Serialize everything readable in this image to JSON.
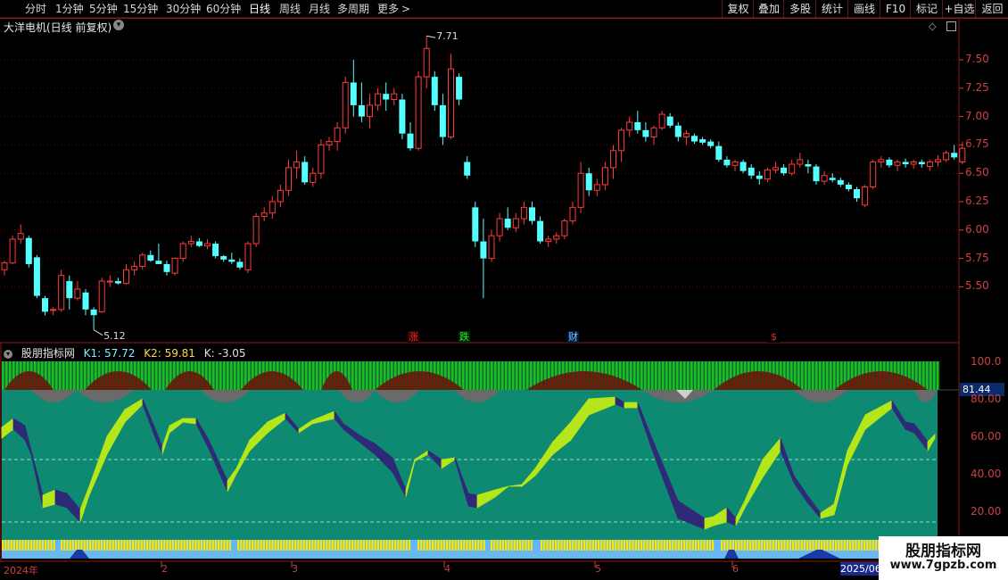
{
  "toolbar": {
    "periods": [
      {
        "label": "分时"
      },
      {
        "label": "1分钟"
      },
      {
        "label": "5分钟"
      },
      {
        "label": "15分钟"
      },
      {
        "label": "30分钟"
      },
      {
        "label": "60分钟"
      },
      {
        "label": "日线"
      },
      {
        "label": "周线"
      },
      {
        "label": "月线"
      },
      {
        "label": "多周期"
      },
      {
        "label": "更多"
      }
    ],
    "right_buttons": [
      {
        "label": "复权"
      },
      {
        "label": "叠加"
      },
      {
        "label": "多股"
      },
      {
        "label": "统计"
      },
      {
        "label": "画线"
      },
      {
        "label": "F10"
      },
      {
        "label": "标记"
      },
      {
        "label": "+自选"
      },
      {
        "label": "返回"
      }
    ],
    "more_chevron": ">"
  },
  "main_chart": {
    "title": "大洋电机(日线 前复权)",
    "high_label": "7.71",
    "low_label": "5.12",
    "y_ticks": [
      "7.50",
      "7.25",
      "7.00",
      "6.75",
      "6.50",
      "6.25",
      "6.00",
      "5.75",
      "5.50"
    ],
    "events": [
      {
        "text": "涨",
        "color": "#e03030",
        "bg": "#2a0000"
      },
      {
        "text": "跌",
        "color": "#30e030",
        "bg": "#002a00"
      },
      {
        "text": "财",
        "color": "#80c0ff",
        "bg": "#001a3a"
      },
      {
        "text": "$",
        "color": "#e03030",
        "bg": "#000000"
      }
    ]
  },
  "indicator": {
    "name": "股朋指标网",
    "k1": "K1: 57.72",
    "k2": "K2: 59.81",
    "k": "K: -3.05",
    "current_value": "81.44",
    "y_ticks": [
      "100.0",
      "80.00",
      "60.00",
      "40.00",
      "20.00"
    ]
  },
  "x_axis": {
    "labels": [
      "2024年",
      "2",
      "3",
      "4",
      "5",
      "6"
    ],
    "current_date": "2025/06"
  },
  "watermark": {
    "title": "股朋指标网",
    "url": "www.7gpzb.com"
  },
  "colors": {
    "up": "#ff3b3b",
    "down": "#54ffff",
    "grid": "#7a0000",
    "teal": "#0f8a72",
    "lime": "#b4e61a",
    "purple": "#2e2a78"
  },
  "chart_data": {
    "type": "candlestick",
    "series": [
      {
        "name": "大洋电机",
        "candles": [
          [
            5.65,
            5.73,
            5.6,
            5.71
          ],
          [
            5.71,
            5.95,
            5.7,
            5.92
          ],
          [
            5.92,
            6.05,
            5.88,
            5.97
          ],
          [
            5.93,
            5.95,
            5.67,
            5.7
          ],
          [
            5.76,
            5.78,
            5.4,
            5.42
          ],
          [
            5.4,
            5.42,
            5.25,
            5.28
          ],
          [
            5.3,
            5.32,
            5.25,
            5.3
          ],
          [
            5.3,
            5.65,
            5.28,
            5.6
          ],
          [
            5.55,
            5.6,
            5.3,
            5.4
          ],
          [
            5.4,
            5.55,
            5.38,
            5.48
          ],
          [
            5.45,
            5.48,
            5.25,
            5.3
          ],
          [
            5.3,
            5.32,
            5.12,
            5.25
          ],
          [
            5.28,
            5.58,
            5.27,
            5.55
          ],
          [
            5.55,
            5.6,
            5.5,
            5.55
          ],
          [
            5.55,
            5.58,
            5.52,
            5.53
          ],
          [
            5.53,
            5.7,
            5.52,
            5.65
          ],
          [
            5.65,
            5.72,
            5.6,
            5.68
          ],
          [
            5.68,
            5.8,
            5.65,
            5.78
          ],
          [
            5.78,
            5.82,
            5.72,
            5.73
          ],
          [
            5.73,
            5.88,
            5.72,
            5.7
          ],
          [
            5.7,
            5.73,
            5.6,
            5.63
          ],
          [
            5.62,
            5.76,
            5.6,
            5.75
          ],
          [
            5.75,
            5.9,
            5.72,
            5.88
          ],
          [
            5.88,
            5.95,
            5.85,
            5.9
          ],
          [
            5.9,
            5.93,
            5.85,
            5.86
          ],
          [
            5.86,
            5.92,
            5.83,
            5.88
          ],
          [
            5.88,
            5.9,
            5.75,
            5.77
          ],
          [
            5.77,
            5.78,
            5.72,
            5.74
          ],
          [
            5.74,
            5.8,
            5.7,
            5.72
          ],
          [
            5.72,
            5.75,
            5.65,
            5.67
          ],
          [
            5.65,
            5.9,
            5.62,
            5.88
          ],
          [
            5.88,
            6.15,
            5.85,
            6.12
          ],
          [
            6.12,
            6.2,
            6.08,
            6.15
          ],
          [
            6.15,
            6.3,
            6.1,
            6.25
          ],
          [
            6.25,
            6.4,
            6.2,
            6.35
          ],
          [
            6.35,
            6.62,
            6.3,
            6.55
          ],
          [
            6.55,
            6.7,
            6.45,
            6.6
          ],
          [
            6.6,
            6.65,
            6.4,
            6.42
          ],
          [
            6.42,
            6.55,
            6.38,
            6.5
          ],
          [
            6.5,
            6.8,
            6.45,
            6.75
          ],
          [
            6.75,
            6.82,
            6.7,
            6.78
          ],
          [
            6.78,
            6.95,
            6.7,
            6.9
          ],
          [
            6.9,
            7.35,
            6.85,
            7.3
          ],
          [
            7.3,
            7.5,
            7.0,
            7.1
          ],
          [
            7.1,
            7.3,
            6.95,
            7.0
          ],
          [
            7.0,
            7.2,
            6.9,
            7.1
          ],
          [
            7.1,
            7.25,
            7.05,
            7.2
          ],
          [
            7.2,
            7.3,
            7.05,
            7.15
          ],
          [
            7.15,
            7.25,
            7.1,
            7.2
          ],
          [
            7.15,
            7.2,
            6.8,
            6.85
          ],
          [
            6.85,
            6.95,
            6.7,
            6.72
          ],
          [
            6.72,
            7.4,
            6.7,
            7.35
          ],
          [
            7.35,
            7.71,
            7.25,
            7.6
          ],
          [
            7.35,
            7.4,
            7.05,
            7.1
          ],
          [
            7.1,
            7.2,
            6.75,
            6.82
          ],
          [
            6.82,
            7.55,
            6.8,
            7.42
          ],
          [
            7.35,
            7.38,
            7.1,
            7.15
          ],
          [
            6.6,
            6.65,
            6.45,
            6.48
          ],
          [
            6.2,
            6.25,
            5.85,
            5.9
          ],
          [
            5.9,
            6.1,
            5.4,
            5.75
          ],
          [
            5.75,
            6.0,
            5.72,
            5.95
          ],
          [
            5.95,
            6.15,
            5.9,
            6.1
          ],
          [
            6.1,
            6.2,
            6.0,
            6.02
          ],
          [
            6.02,
            6.15,
            5.98,
            6.1
          ],
          [
            6.1,
            6.25,
            6.05,
            6.2
          ],
          [
            6.2,
            6.25,
            6.05,
            6.08
          ],
          [
            6.08,
            6.12,
            5.88,
            5.9
          ],
          [
            5.9,
            5.95,
            5.85,
            5.92
          ],
          [
            5.92,
            5.98,
            5.88,
            5.95
          ],
          [
            5.95,
            6.1,
            5.92,
            6.08
          ],
          [
            6.08,
            6.25,
            6.05,
            6.2
          ],
          [
            6.2,
            6.6,
            6.15,
            6.5
          ],
          [
            6.5,
            6.55,
            6.3,
            6.35
          ],
          [
            6.35,
            6.45,
            6.3,
            6.4
          ],
          [
            6.4,
            6.6,
            6.35,
            6.55
          ],
          [
            6.55,
            6.75,
            6.45,
            6.7
          ],
          [
            6.7,
            6.9,
            6.6,
            6.88
          ],
          [
            6.88,
            7.0,
            6.82,
            6.95
          ],
          [
            6.95,
            7.05,
            6.85,
            6.88
          ],
          [
            6.88,
            6.95,
            6.78,
            6.82
          ],
          [
            6.82,
            6.92,
            6.75,
            6.9
          ],
          [
            6.9,
            7.05,
            6.88,
            7.02
          ],
          [
            7.0,
            7.03,
            6.9,
            6.92
          ],
          [
            6.92,
            6.95,
            6.78,
            6.82
          ],
          [
            6.82,
            6.88,
            6.75,
            6.85
          ],
          [
            6.83,
            6.85,
            6.76,
            6.78
          ],
          [
            6.8,
            6.82,
            6.75,
            6.77
          ],
          [
            6.78,
            6.8,
            6.72,
            6.74
          ],
          [
            6.74,
            6.78,
            6.6,
            6.62
          ],
          [
            6.62,
            6.65,
            6.55,
            6.57
          ],
          [
            6.57,
            6.62,
            6.52,
            6.6
          ],
          [
            6.6,
            6.62,
            6.5,
            6.52
          ],
          [
            6.55,
            6.58,
            6.45,
            6.48
          ],
          [
            6.48,
            6.52,
            6.4,
            6.45
          ],
          [
            6.45,
            6.55,
            6.42,
            6.53
          ],
          [
            6.53,
            6.6,
            6.5,
            6.55
          ],
          [
            6.55,
            6.58,
            6.48,
            6.5
          ],
          [
            6.5,
            6.62,
            6.48,
            6.58
          ],
          [
            6.58,
            6.68,
            6.55,
            6.62
          ],
          [
            6.58,
            6.62,
            6.5,
            6.56
          ],
          [
            6.56,
            6.58,
            6.4,
            6.43
          ],
          [
            6.43,
            6.52,
            6.4,
            6.48
          ],
          [
            6.46,
            6.5,
            6.42,
            6.44
          ],
          [
            6.44,
            6.46,
            6.38,
            6.4
          ],
          [
            6.4,
            6.42,
            6.34,
            6.36
          ],
          [
            6.36,
            6.38,
            6.25,
            6.28
          ],
          [
            6.22,
            6.4,
            6.2,
            6.38
          ],
          [
            6.38,
            6.62,
            6.36,
            6.6
          ],
          [
            6.6,
            6.65,
            6.55,
            6.62
          ],
          [
            6.62,
            6.64,
            6.55,
            6.57
          ],
          [
            6.57,
            6.62,
            6.52,
            6.6
          ],
          [
            6.6,
            6.63,
            6.55,
            6.58
          ],
          [
            6.58,
            6.62,
            6.54,
            6.6
          ],
          [
            6.6,
            6.62,
            6.55,
            6.58
          ],
          [
            6.56,
            6.62,
            6.52,
            6.6
          ],
          [
            6.6,
            6.66,
            6.56,
            6.62
          ],
          [
            6.62,
            6.7,
            6.6,
            6.68
          ],
          [
            6.68,
            6.75,
            6.62,
            6.64
          ],
          [
            6.6,
            6.78,
            6.58,
            6.72
          ]
        ]
      }
    ],
    "ylim": [
      5.3,
      7.75
    ]
  }
}
